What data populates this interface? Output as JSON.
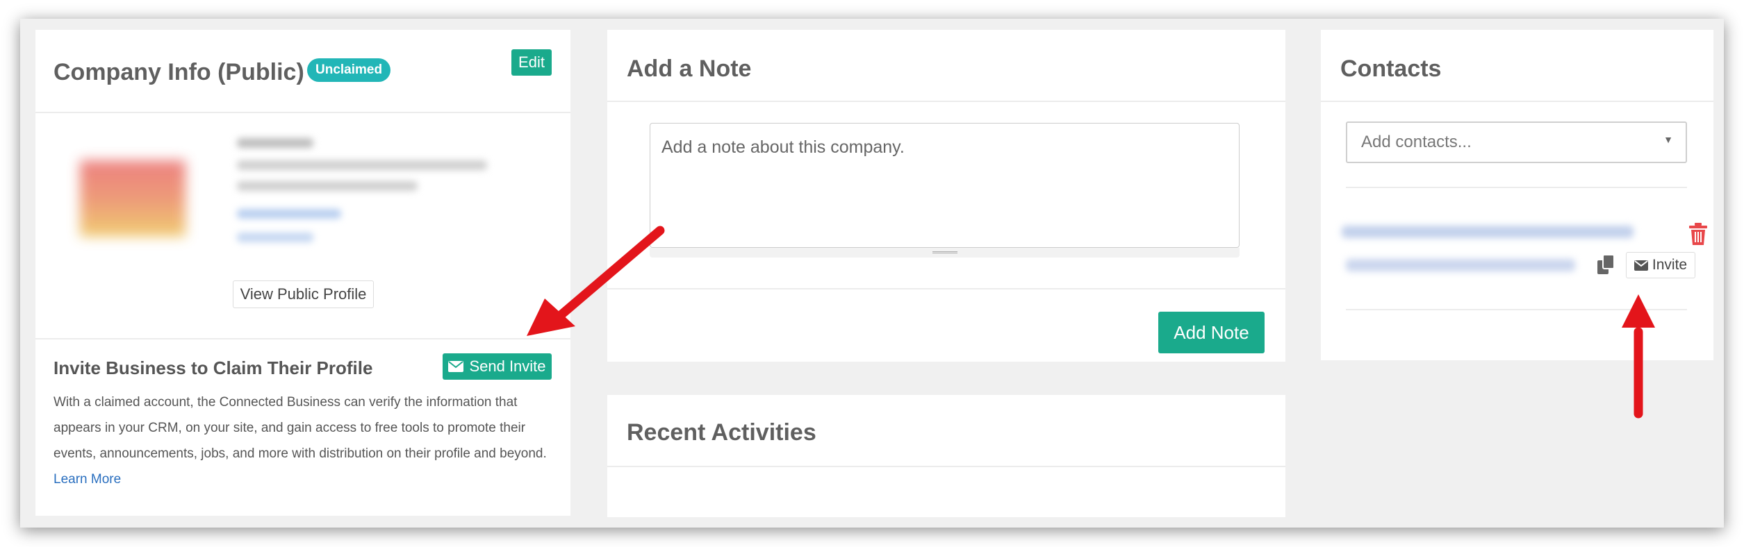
{
  "company": {
    "title": "Company Info (Public)",
    "badge": "Unclaimed",
    "edit_label": "Edit",
    "view_profile_label": "View Public Profile",
    "invite": {
      "title": "Invite Business to Claim Their Profile",
      "send_label": "Send Invite",
      "description": "With a claimed account, the Connected Business can verify the information that appears in your CRM, on your site, and gain access to free tools to promote their events, announcements, jobs, and more with distribution on their profile and beyond.",
      "learn_more": "Learn More"
    }
  },
  "note": {
    "title": "Add a Note",
    "placeholder": "Add a note about this company.",
    "add_label": "Add Note"
  },
  "recent": {
    "title": "Recent Activities"
  },
  "contacts": {
    "title": "Contacts",
    "placeholder": "Add contacts...",
    "invite_label": "Invite"
  },
  "colors": {
    "accent_green": "#1aaa8c",
    "badge_teal": "#22b6b7",
    "danger_red": "#e8474a",
    "arrow_red": "#e3151b",
    "link_blue": "#2a6fbf"
  },
  "icons": [
    "envelope-icon",
    "trash-icon",
    "copy-icon",
    "caret-down-icon"
  ]
}
